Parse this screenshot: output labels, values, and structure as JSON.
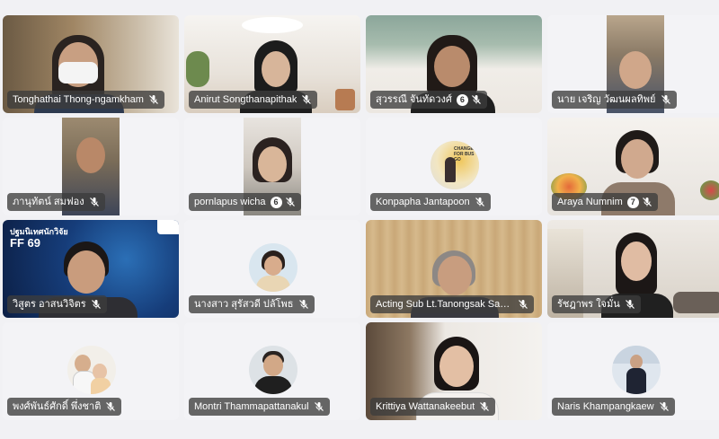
{
  "participants": [
    {
      "name": "Tonghathai Thong-ngamkham",
      "hand": false
    },
    {
      "name": "Anirut Songthanapithak",
      "hand": false
    },
    {
      "name": "สุวรรณี จันทัดวงศ์",
      "hand": true,
      "hand_count": "6"
    },
    {
      "name": "นาย เจริญ วัฒนผลทิพย์",
      "hand": false
    },
    {
      "name": "ภานุทัตน์ สมฟอง",
      "hand": false
    },
    {
      "name": "pornlapus wicha",
      "hand": true,
      "hand_count": "6"
    },
    {
      "name": "Konpapha Jantapoon",
      "hand": false
    },
    {
      "name": "Araya Numnim",
      "hand": true,
      "hand_count": "7"
    },
    {
      "name": "วิสูตร อาสนวิจิตร",
      "hand": false
    },
    {
      "name": "นางสาว สุรัสวดี ปลัโพธ",
      "hand": false
    },
    {
      "name": "Acting Sub Lt.Tanongsak Sass...",
      "hand": false
    },
    {
      "name": "รัชฎาพร ใจมั่น",
      "hand": false
    },
    {
      "name": "พงศ์พันธ์ศักดิ์ พึ่งชาติ",
      "hand": false
    },
    {
      "name": "Montri Thammapattanakul",
      "hand": false
    },
    {
      "name": "Krittiya Wattanakeebut",
      "hand": false
    },
    {
      "name": "Naris Khampangkaew",
      "hand": false
    }
  ],
  "overlay_texts": {
    "poster_line1": "ปฐมนิเทศนักวิจัย",
    "poster_line2": "FF 69",
    "avatar_poster_text": "CHANGE FOR BUS GO"
  },
  "colors": {
    "page_bg": "#f1f1f4",
    "label_bg": "#3c3c3c",
    "tile_light": "#f3f3f6"
  },
  "icons": {
    "mute": "mic-off-icon",
    "hand": "raised-hand-icon"
  }
}
